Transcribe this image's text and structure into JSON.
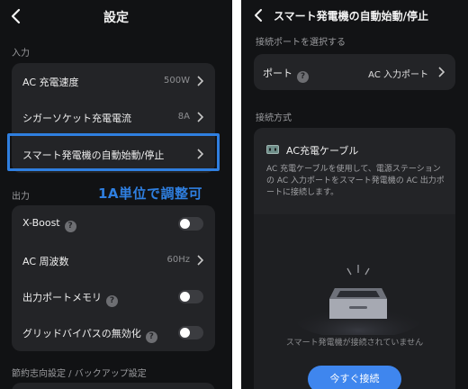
{
  "left": {
    "title": "設定",
    "sections": {
      "input": "入力",
      "output": "出力",
      "eco": "節約志向設定 / バックアップ設定"
    },
    "input_rows": [
      {
        "label": "AC 充電速度",
        "value": "500W"
      },
      {
        "label": "シガーソケット充電電流",
        "value": "8A"
      },
      {
        "label": "スマート発電機の自動始動/停止",
        "value": ""
      }
    ],
    "output_rows": [
      {
        "label": "X-Boost",
        "toggle": false,
        "help": "?"
      },
      {
        "label": "AC 周波数",
        "value": "60Hz"
      },
      {
        "label": "出力ポートメモリ",
        "toggle": false,
        "help": "?"
      },
      {
        "label": "グリッドバイパスの無効化",
        "toggle": false,
        "help": "?"
      }
    ],
    "annotation": "1A単位で調整可",
    "highlight_color": "#2f7fe0"
  },
  "right": {
    "title": "スマート発電機の自動始動/停止",
    "port_section": "接続ポートを選択する",
    "port_label": "ポート",
    "port_help": "?",
    "port_value": "AC 入力ポート",
    "method_section": "接続方式",
    "cable_title": "AC充電ケーブル",
    "cable_desc": "AC 充電ケーブルを使用して、電源ステーションの AC 入力ポートをスマート発電機の AC 出力ポートに接続します。",
    "status": "スマート発電機が接続されていません",
    "connect_button": "今すぐ接続",
    "accent_color": "#3f86ee"
  }
}
